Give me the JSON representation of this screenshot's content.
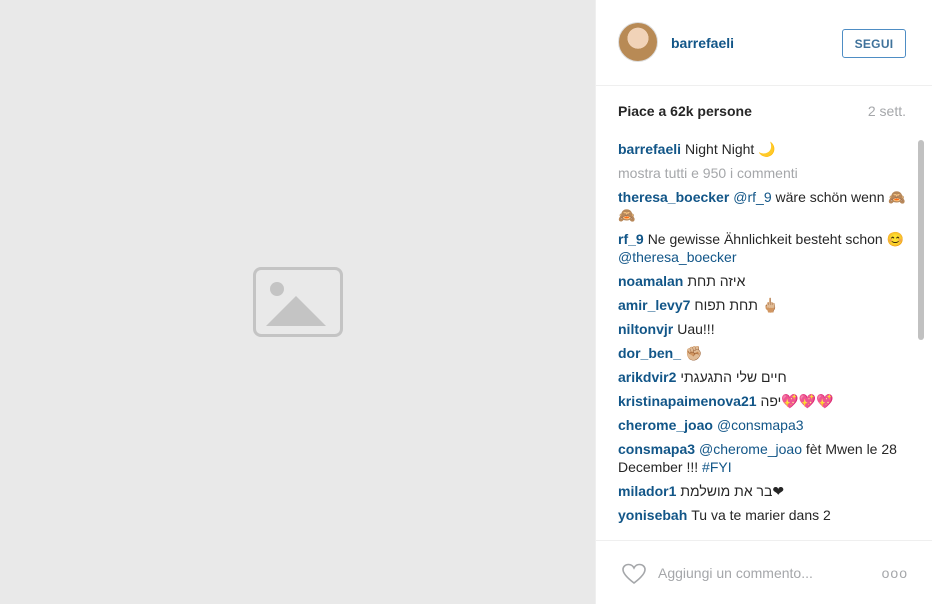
{
  "post": {
    "username": "barrefaeli",
    "follow_label": "SEGUI",
    "likes": "Piace a 62k persone",
    "age": "2 sett.",
    "add_comment_placeholder": "Aggiungi un commento...",
    "more_label": "ooo"
  },
  "comments": [
    {
      "user": "barrefaeli",
      "text": "Night Night 🌙"
    },
    {
      "user": "",
      "text": "mostra tutti e 950 i commenti",
      "muted": true
    },
    {
      "user": "theresa_boecker",
      "mention": "@rf_9",
      "text": "wäre schön wenn 🙈🙈"
    },
    {
      "user": "rf_9",
      "text": "Ne gewisse Ähnlichkeit besteht schon 😊",
      "mention_after": "@theresa_boecker"
    },
    {
      "user": "noamalan",
      "text": "איזה תחת"
    },
    {
      "user": "amir_levy7",
      "text": "תחת תפוח 🖕🏼"
    },
    {
      "user": "niltonvjr",
      "text": "Uau!!!"
    },
    {
      "user": "dor_ben_",
      "text": "✊🏼"
    },
    {
      "user": "arikdvir2",
      "text": "חיים שלי התגעגתי"
    },
    {
      "user": "kristinapaimenova21",
      "text": "יפה💖💖💖"
    },
    {
      "user": "cherome_joao",
      "mention": "@consmapa3",
      "text": ""
    },
    {
      "user": "consmapa3",
      "mention": "@cherome_joao",
      "text": "fèt Mwen le 28 December !!!",
      "mention_after": "#FYI"
    },
    {
      "user": "milador1",
      "text": "בר את מושלמת❤"
    },
    {
      "user": "yonisebah",
      "text": "Tu va te marier dans 2"
    }
  ],
  "icons": {
    "heart": "heart-icon",
    "more": "more-options-icon",
    "photo": "image-placeholder-icon"
  }
}
